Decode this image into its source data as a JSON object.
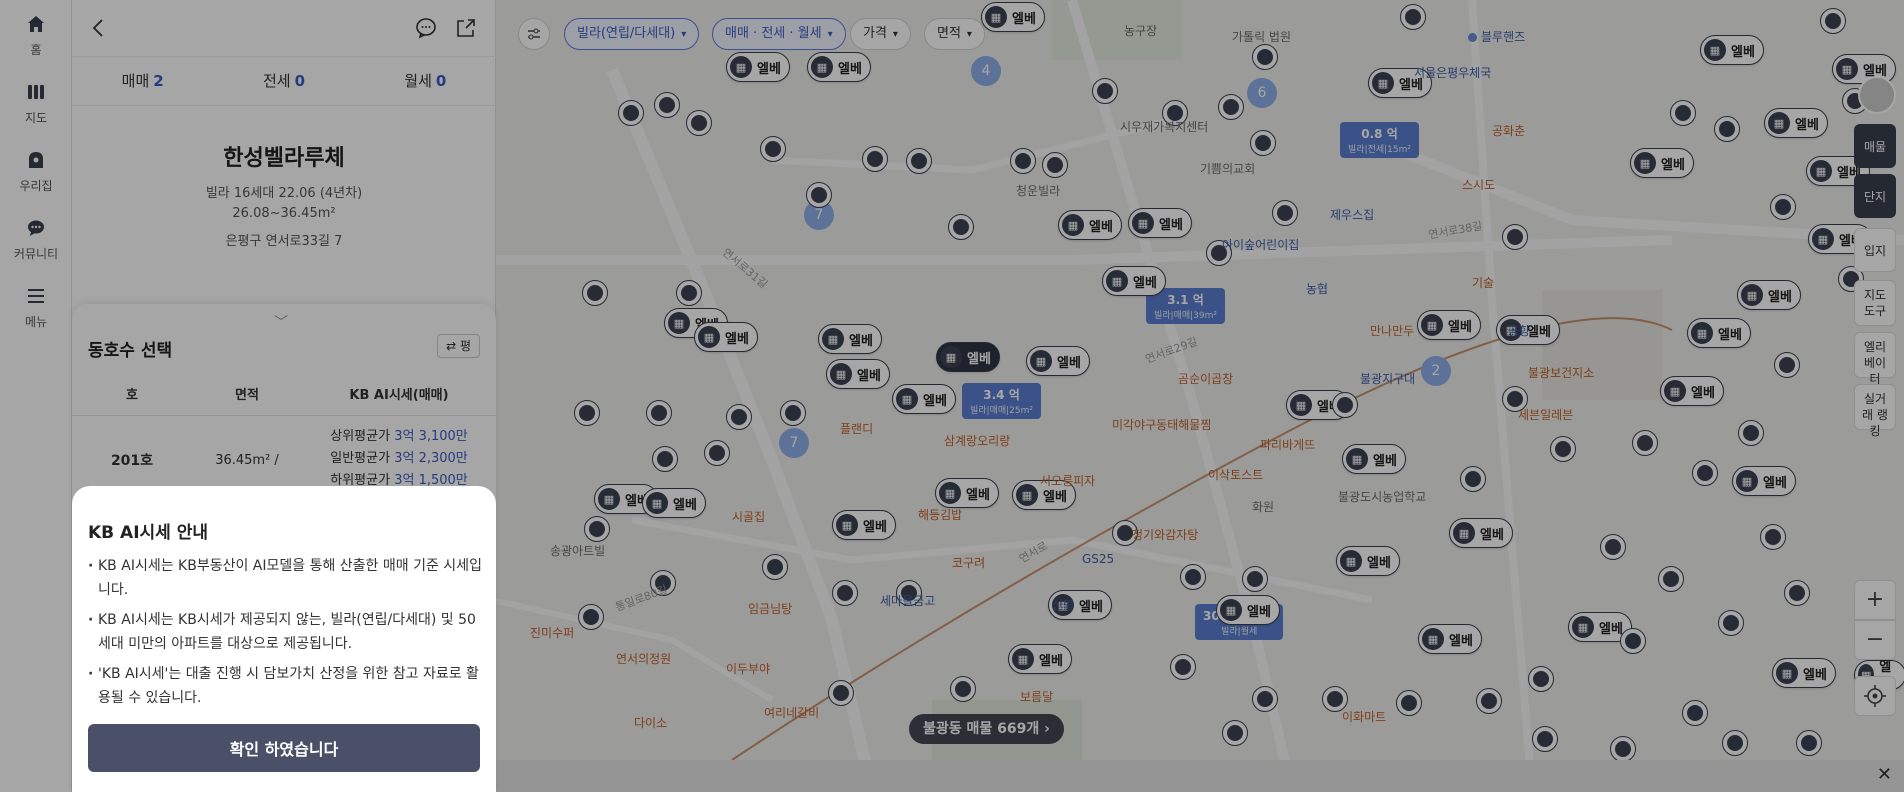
{
  "nav": {
    "items": [
      {
        "label": "홈",
        "icon": "home-icon"
      },
      {
        "label": "지도",
        "icon": "map-icon"
      },
      {
        "label": "우리집",
        "icon": "my-home-icon"
      },
      {
        "label": "커뮤니티",
        "icon": "community-icon"
      },
      {
        "label": "메뉴",
        "icon": "menu-icon"
      }
    ]
  },
  "panel": {
    "tabs": [
      {
        "label": "매매",
        "count": "2"
      },
      {
        "label": "전세",
        "count": "0"
      },
      {
        "label": "월세",
        "count": "0"
      }
    ],
    "title": "한성벨라루체",
    "info": "빌라  16세대  22.06 (4년차)",
    "area": "26.08~36.45m²",
    "address": "은평구 연서로33길 7"
  },
  "units": {
    "title": "동호수 선택",
    "toggle": "평",
    "headers": [
      "호",
      "면적",
      "KB AI시세(매매)"
    ],
    "rows": [
      {
        "ho": "201호",
        "area": "36.45m² / 29.88m²",
        "upper_label": "상위평균가",
        "upper": "3억 3,100만",
        "mid_label": "일반평균가",
        "mid": "3억 2,300만",
        "lower_label": "하위평균가",
        "lower": "3억 1,500만"
      }
    ]
  },
  "kb_modal": {
    "title": "KB AI시세 안내",
    "bullets": [
      "KB AI시세는 KB부동산이 AI모델을 통해 산출한 매매 기준 시세입니다.",
      "KB AI시세는 KB시세가 제공되지 않는, 빌라(연립/다세대) 및 50세대 미만의 아파트를 대상으로 제공됩니다.",
      "'KB AI시세'는 대출 진행 시 담보가치 산정을 위한 참고 자료로 활용될 수 있습니다."
    ],
    "confirm": "확인 하였습니다"
  },
  "map": {
    "filters": [
      "빌라(연립/다세대)",
      "매매 · 전세 · 월세",
      "가격",
      "면적"
    ],
    "total": "불광동 매물 669개",
    "pin_label": "엘베",
    "selected_pin": "엘베",
    "price_tags": [
      {
        "price": "0.8 억",
        "sub": "빌라|전세|15m²"
      },
      {
        "price": "3.1 억",
        "sub": "빌라|매매|39m²"
      },
      {
        "price": "3.4 억",
        "sub": "빌라|매매|25m²"
      },
      {
        "price": "300만/23 만",
        "sub": "빌라|월세"
      }
    ],
    "clusters": [
      "4",
      "6",
      "7",
      "7",
      "2"
    ],
    "places": [
      {
        "name": "농구장",
        "style": ""
      },
      {
        "name": "가톨릭 법원",
        "style": ""
      },
      {
        "name": "블루핸즈",
        "style": "blue"
      },
      {
        "name": "서울은평우체국",
        "style": "blue"
      },
      {
        "name": "시우재가복지센터",
        "style": ""
      },
      {
        "name": "기쁨의교회",
        "style": ""
      },
      {
        "name": "공화춘",
        "style": "orange"
      },
      {
        "name": "스시도",
        "style": "orange"
      },
      {
        "name": "청운빌라",
        "style": ""
      },
      {
        "name": "아이숲어린이집",
        "style": "blue"
      },
      {
        "name": "제우스집",
        "style": "blue"
      },
      {
        "name": "기술",
        "style": "orange"
      },
      {
        "name": "농협",
        "style": "blue"
      },
      {
        "name": "만나만두",
        "style": "orange"
      },
      {
        "name": "공항",
        "style": "blue"
      },
      {
        "name": "불광보건지소",
        "style": "orange"
      },
      {
        "name": "세븐일레븐",
        "style": "orange"
      },
      {
        "name": "플랜디",
        "style": "orange"
      },
      {
        "name": "삼계랑오리랑",
        "style": "orange"
      },
      {
        "name": "미각야구동태해물찜",
        "style": "orange"
      },
      {
        "name": "파리바게뜨",
        "style": "orange"
      },
      {
        "name": "서오릉피자",
        "style": "orange"
      },
      {
        "name": "이삭토스트",
        "style": "orange"
      },
      {
        "name": "불광도시농업학교",
        "style": ""
      },
      {
        "name": "시골집",
        "style": "orange"
      },
      {
        "name": "송광아트빌",
        "style": ""
      },
      {
        "name": "코구려",
        "style": "orange"
      },
      {
        "name": "청기와감자탕",
        "style": "orange"
      },
      {
        "name": "GS25",
        "style": "blue"
      },
      {
        "name": "세마을금고",
        "style": "blue"
      },
      {
        "name": "신협",
        "style": "blue"
      },
      {
        "name": "임금님탕",
        "style": "orange"
      },
      {
        "name": "진미수퍼",
        "style": "orange"
      },
      {
        "name": "연서의정원",
        "style": "orange"
      },
      {
        "name": "이두부야",
        "style": "orange"
      },
      {
        "name": "보름달",
        "style": "orange"
      },
      {
        "name": "다이소",
        "style": "orange"
      },
      {
        "name": "여리네갈비",
        "style": "orange"
      },
      {
        "name": "이화마트",
        "style": "orange"
      },
      {
        "name": "곰순이곱창",
        "style": "orange"
      },
      {
        "name": "불광지구대",
        "style": "blue"
      },
      {
        "name": "해등김밥",
        "style": "orange"
      },
      {
        "name": "화원",
        "style": ""
      }
    ],
    "roads": [
      "연서로31길",
      "연서로38길",
      "연서로",
      "연서로29길",
      "통일로80길"
    ]
  },
  "right_controls": [
    "매물",
    "단지",
    "입지",
    "지도 도구",
    "엘리 베이터",
    "실거래 랭킹"
  ],
  "colors": {
    "accent": "#3b5cc4",
    "pin_dark": "#3b4253",
    "confirm": "#4a5068",
    "price_tag": "#5a7fd1"
  }
}
